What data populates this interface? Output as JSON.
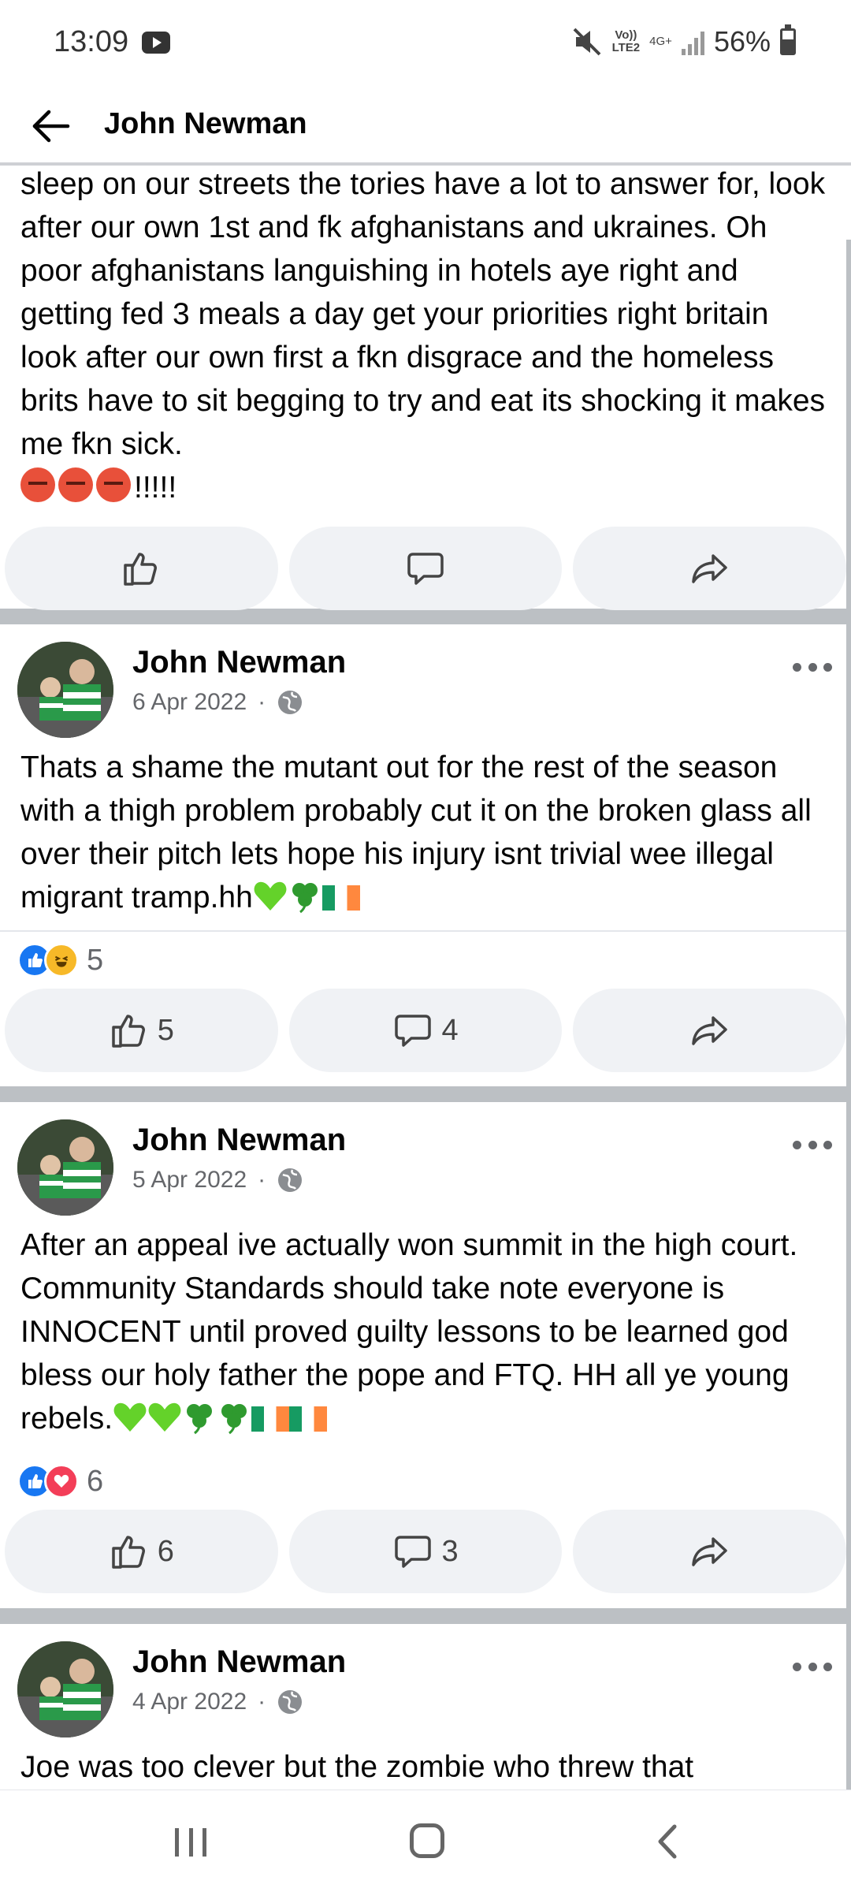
{
  "status_bar": {
    "time": "13:09",
    "volte": "Vo))",
    "lte": "LTE2",
    "network": "4G+",
    "battery": "56%"
  },
  "header": {
    "title": "John Newman"
  },
  "posts": [
    {
      "text": "sleep on our streets the tories have a lot to answer for, look after our own 1st and fk afghanistans and ukraines. Oh poor afghanistans languishing in hotels aye right and getting fed 3 meals a day get your priorities right  britain look after our own first a fkn disgrace and the homeless brits have to sit begging to try and eat its shocking it makes me fkn sick.",
      "trailing": "!!!!!"
    },
    {
      "author": "John Newman",
      "date": "6 Apr 2022",
      "separator": "·",
      "text": "Thats a shame the mutant out for the rest of the season with a thigh problem probably cut it on the broken glass all over their pitch lets hope his injury isnt trivial wee illegal migrant tramp.hh",
      "reaction_count": "5",
      "like_count": "5",
      "comment_count": "4"
    },
    {
      "author": "John Newman",
      "date": "5 Apr 2022",
      "separator": "·",
      "text": "After an appeal ive actually won summit in the high court. Community Standards should take note everyone is INNOCENT until proved guilty lessons to be learned god bless our holy father the pope and FTQ. HH all ye young rebels.",
      "reaction_count": "6",
      "like_count": "6",
      "comment_count": "3"
    },
    {
      "author": "John Newman",
      "date": "4 Apr 2022",
      "separator": "·",
      "text": "Joe was too clever but the zombie who threw that"
    }
  ],
  "icons": {
    "like": "thumbs-up-icon",
    "comment": "comment-bubble-icon",
    "share": "share-arrow-icon",
    "privacy": "globe-icon",
    "more": "more-dots-icon"
  },
  "colors": {
    "like_blue": "#1877f2",
    "love_red": "#f33e58",
    "haha_yellow": "#f7b928",
    "button_bg": "#f0f2f5",
    "divider": "#bcc0c4",
    "secondary_text": "#65676b"
  }
}
